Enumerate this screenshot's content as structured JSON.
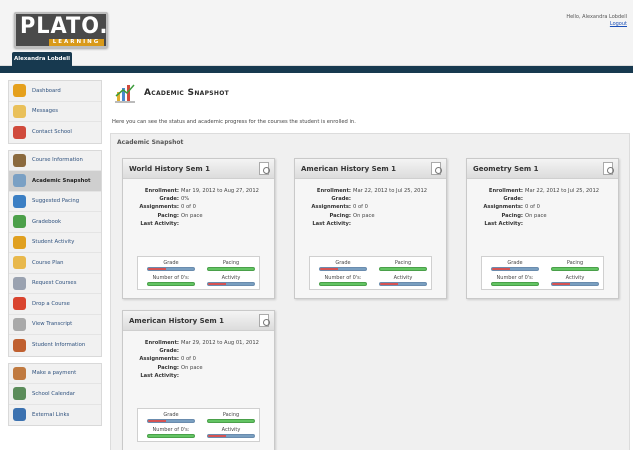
{
  "header": {
    "logo_word": "PLATO.",
    "logo_sub": "LEARNING",
    "user_tab": "Alexandra Lobdell",
    "hello": "Hello, Alexandra Lobdell",
    "logout": "Logout"
  },
  "sidebar": {
    "group1": [
      {
        "label": "Dashboard",
        "icon": "dashboard-icon",
        "color": "#e5a01c"
      },
      {
        "label": "Messages",
        "icon": "messages-icon",
        "color": "#e9c05a"
      },
      {
        "label": "Contact School",
        "icon": "contact-icon",
        "color": "#d04a3c"
      }
    ],
    "group2": [
      {
        "label": "Course Information",
        "icon": "course-info-icon",
        "color": "#8b6a3e"
      },
      {
        "label": "Academic Snapshot",
        "icon": "snapshot-icon",
        "color": "#7aa0c4",
        "active": true
      },
      {
        "label": "Suggested Pacing",
        "icon": "pacing-icon",
        "color": "#3b7fc4"
      },
      {
        "label": "Gradebook",
        "icon": "gradebook-icon",
        "color": "#4ca04a"
      },
      {
        "label": "Student Activity",
        "icon": "activity-icon",
        "color": "#e0a020"
      },
      {
        "label": "Course Plan",
        "icon": "course-plan-icon",
        "color": "#e8b84c"
      },
      {
        "label": "Request Courses",
        "icon": "request-icon",
        "color": "#9aa2b0"
      },
      {
        "label": "Drop a Course",
        "icon": "drop-icon",
        "color": "#d9442f"
      },
      {
        "label": "View Transcript",
        "icon": "transcript-icon",
        "color": "#a9a9a9"
      },
      {
        "label": "Student Information",
        "icon": "student-info-icon",
        "color": "#c06030"
      }
    ],
    "group3": [
      {
        "label": "Make a payment",
        "icon": "payment-icon",
        "color": "#c07a40"
      },
      {
        "label": "School Calendar",
        "icon": "calendar-icon",
        "color": "#5b8c5a"
      },
      {
        "label": "External Links",
        "icon": "external-links-icon",
        "color": "#3c72b0"
      }
    ]
  },
  "main": {
    "title": "Academic Snapshot",
    "description": "Here you can see the status and academic progress for the courses the student is enrolled in.",
    "panel_title": "Academic Snapshot"
  },
  "labels": {
    "enrollment": "Enrollment:",
    "grade": "Grade:",
    "assignments": "Assignments:",
    "pacing": "Pacing:",
    "last_activity": "Last Activity:",
    "bar_grade": "Grade",
    "bar_pacing": "Pacing",
    "bar_zeros": "Number of 0's:",
    "bar_activity": "Activity"
  },
  "courses": [
    {
      "title": "World History Sem 1",
      "enrollment": "Mar 19, 2012 to Aug 27, 2012",
      "grade": "0%",
      "assignments": "0 of 0",
      "pacing": "On pace",
      "last_activity": ""
    },
    {
      "title": "American History Sem 1",
      "enrollment": "Mar 22, 2012 to Jul 25, 2012",
      "grade": "",
      "assignments": "0 of 0",
      "pacing": "On pace",
      "last_activity": ""
    },
    {
      "title": "Geometry Sem 1",
      "enrollment": "Mar 22, 2012 to Jul 25, 2012",
      "grade": "",
      "assignments": "0 of 0",
      "pacing": "On pace",
      "last_activity": ""
    },
    {
      "title": "American History Sem 1",
      "enrollment": "Mar 29, 2012 to Aug 01, 2012",
      "grade": "",
      "assignments": "0 of 0",
      "pacing": "On pace",
      "last_activity": ""
    }
  ]
}
